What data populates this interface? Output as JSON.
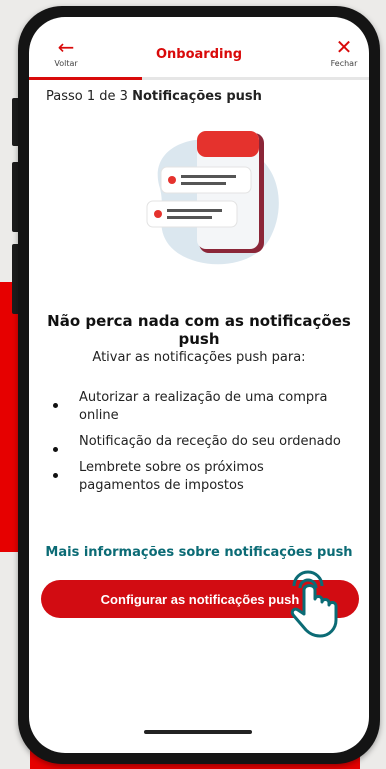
{
  "header": {
    "back_label": "Voltar",
    "title": "Onboarding",
    "close_label": "Fechar",
    "progress_fraction": 0.333
  },
  "step": {
    "prefix": "Passo 1 de 3",
    "name": "Notificações push"
  },
  "content": {
    "heading": "Não perca nada com as notificações push",
    "intro": "Ativar as notificações push para:",
    "bullets": [
      "Autorizar a realização de uma compra online",
      "Notificação da receção do seu ordenado",
      "Lembrete sobre os próximos pagamentos de impostos"
    ],
    "more_info_link": "Mais informações sobre notificações push"
  },
  "cta": {
    "label": "Configurar as notificações push"
  },
  "colors": {
    "accent": "#d90a0a",
    "link": "#0b6b75",
    "button": "#d20c12"
  },
  "icons": {
    "back": "arrow-left-icon",
    "close": "close-icon",
    "illustration": "phone-notifications-illustration",
    "tap": "hand-tap-icon"
  }
}
